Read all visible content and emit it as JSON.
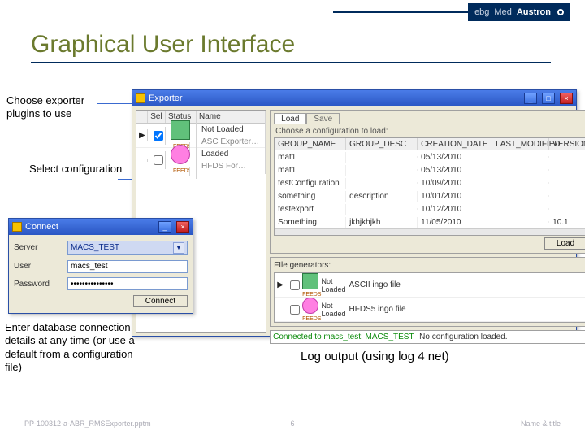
{
  "brand": {
    "ebg": "ebg",
    "med": "Med",
    "austron": "Austron"
  },
  "title": "Graphical User Interface",
  "callouts": {
    "choose": "Choose exporter plugins to use",
    "select": "Select configuration",
    "enter": "Enter database connection details at any time (or use a default from a configuration file)",
    "log": "Log output (using log 4 net)"
  },
  "exporter": {
    "title": "Exporter",
    "win_min": "_",
    "win_max": "□",
    "win_close": "×",
    "plugins": {
      "headers": {
        "sel": "Sel",
        "status": "Status",
        "name": "Name"
      },
      "rows": [
        {
          "arrow": "▶",
          "checked": true,
          "iconKind": "face",
          "status": "Not Loaded",
          "name": "ASC  Exporter…"
        },
        {
          "arrow": "",
          "checked": false,
          "iconKind": "flower",
          "status": "Loaded",
          "name": "HFDS For…"
        }
      ],
      "feeds": "FEEDS"
    },
    "conf": {
      "tabs": {
        "load": "Load",
        "save": "Save"
      },
      "label": "Choose a configuration to load:",
      "headers": {
        "c1": "GROUP_NAME",
        "c2": "GROUP_DESC",
        "c3": "CREATION_DATE",
        "c4": "LAST_MODIFIED",
        "c5": "VERSION"
      },
      "rows": [
        {
          "c1": "mat1",
          "c2": "",
          "c3": "05/13/2010",
          "c4": "",
          "c5": ""
        },
        {
          "c1": "mat1",
          "c2": "",
          "c3": "05/13/2010",
          "c4": "",
          "c5": ""
        },
        {
          "c1": "testConfiguration",
          "c2": "",
          "c3": "10/09/2010",
          "c4": "",
          "c5": ""
        },
        {
          "c1": "something",
          "c2": "description",
          "c3": "10/01/2010",
          "c4": "",
          "c5": ""
        },
        {
          "c1": "testexport",
          "c2": "",
          "c3": "10/12/2010",
          "c4": "",
          "c5": ""
        },
        {
          "c1": "Something",
          "c2": "jkhjkhjkh",
          "c3": "11/05/2010",
          "c4": "",
          "c5": "10.1"
        }
      ],
      "load_btn": "Load"
    },
    "filegen": {
      "heading": "FIle generators:",
      "rows": [
        {
          "arrow": "▶",
          "checked": false,
          "iconKind": "face",
          "status": "Not Loaded",
          "name": "ASCII ingo file"
        },
        {
          "arrow": "",
          "checked": false,
          "iconKind": "flower",
          "status": "Not Loaded",
          "name": "HFDS5 ingo file"
        }
      ],
      "feeds": "FEEDS"
    },
    "log": {
      "line1_a": "Connected to macs_test:",
      "line1_b": "MACS_TEST",
      "line2": "No configuration loaded."
    }
  },
  "connect": {
    "title": "Connect",
    "win_min": "_",
    "win_close": "×",
    "labels": {
      "server": "Server",
      "user": "User",
      "password": "Password"
    },
    "values": {
      "server": "MACS_TEST",
      "user": "macs_test",
      "password": "•••••••••••••••"
    },
    "dd": "▼",
    "connect_btn": "Connect"
  },
  "footer": {
    "left": "PP-100312-a-ABR_RMSExporter.pptm",
    "center": "6",
    "right": "Name & title"
  }
}
